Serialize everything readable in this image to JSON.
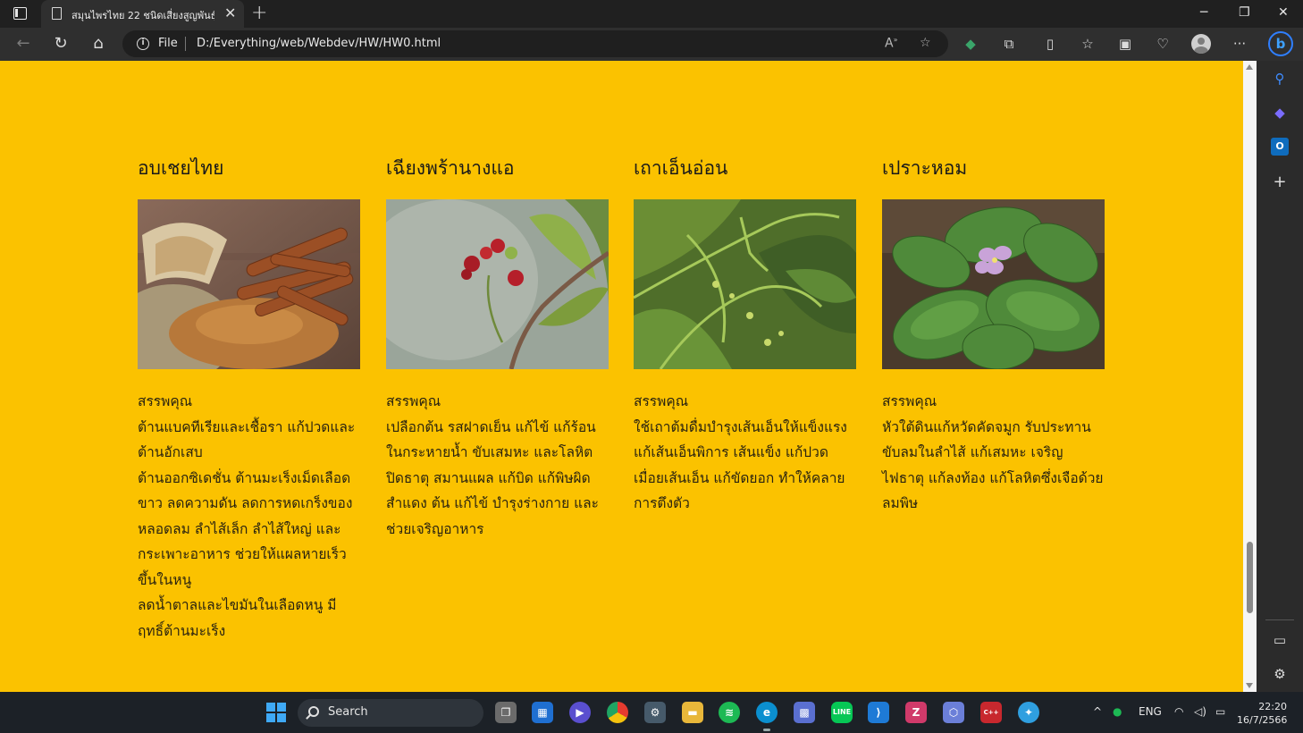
{
  "browser": {
    "tab_title": "สมุนไพรไทย 22 ชนิดเสี่ยงสูญพันธุ์",
    "file_label": "File",
    "url": "D:/Everything/web/Webdev/HW/HW0.html"
  },
  "herbs": [
    {
      "name": "อบเชยไทย",
      "benefit_heading": "สรรพคุณ",
      "lines": [
        "ต้านแบคทีเรียและเชื้อรา แก้ปวดและต้านอักเสบ",
        "ต้านออกซิเดชั่น ต้านมะเร็งเม็ดเลือดขาว ลดความดัน ลดการหดเกร็งของหลอดลม ลำไส้เล็ก ลำไส้ใหญ่ และกระเพาะอาหาร ช่วยให้แผลหายเร็วขึ้นในหนู",
        "ลดน้ำตาลและไขมันในเลือดหนู มีฤทธิ์ต้านมะเร็ง"
      ]
    },
    {
      "name": "เฉียงพร้านางแอ",
      "benefit_heading": "สรรพคุณ",
      "lines": [
        "เปลือกต้น รสฝาดเย็น แก้ไข้ แก้ร้อนในกระหายน้ำ ขับเสมหะ และโลหิต ปิดธาตุ สมานแผล แก้บิด แก้พิษผิดสำแดง ต้น แก้ไข้ บำรุงร่างกาย และช่วยเจริญอาหาร"
      ]
    },
    {
      "name": "เถาเอ็นอ่อน",
      "benefit_heading": "สรรพคุณ",
      "lines": [
        "ใช้เถาต้มดื่มบำรุงเส้นเอ็นให้แข็งแรง แก้เส้นเอ็นพิการ เส้นแข็ง แก้ปวดเมื่อยเส้นเอ็น แก้ขัดยอก ทำให้คลายการตึงตัว"
      ]
    },
    {
      "name": "เปราะหอม",
      "benefit_heading": "สรรพคุณ",
      "lines": [
        "หัวใต้ดินแก้หวัดคัดจมูก รับประทานขับลมในลำไส้ แก้เสมหะ เจริญไฟธาตุ แก้ลงท้อง แก้โลหิตซึ่งเจือด้วยลมพิษ"
      ]
    }
  ],
  "taskbar": {
    "search_label": "Search",
    "language": "ENG",
    "time": "22:20",
    "date": "16/7/2566"
  },
  "colors": {
    "page_background": "#fbc200"
  }
}
